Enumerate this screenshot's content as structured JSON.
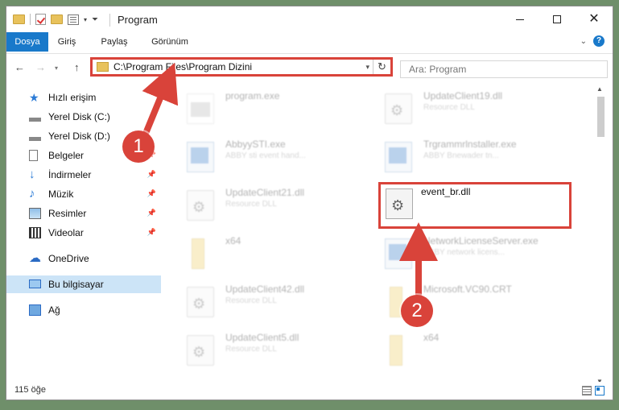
{
  "window": {
    "title": "Program"
  },
  "ribbon": {
    "tabs": [
      "Dosya",
      "Giriş",
      "Paylaş",
      "Görünüm"
    ]
  },
  "address": {
    "path": "C:\\Program Files\\Program Dizini"
  },
  "search": {
    "placeholder": "Ara: Program"
  },
  "nav": {
    "items": [
      {
        "label": "Hızlı erişim",
        "icon": "star-icon"
      },
      {
        "label": "Yerel Disk (C:)",
        "icon": "drive-icon"
      },
      {
        "label": "Yerel Disk (D:)",
        "icon": "drive-icon"
      },
      {
        "label": "Belgeler",
        "icon": "document-icon"
      },
      {
        "label": "İndirmeler",
        "icon": "download-icon"
      },
      {
        "label": "Müzik",
        "icon": "music-icon"
      },
      {
        "label": "Resimler",
        "icon": "pictures-icon"
      },
      {
        "label": "Videolar",
        "icon": "videos-icon"
      },
      {
        "label": "OneDrive",
        "icon": "cloud-icon"
      },
      {
        "label": "Bu bilgisayar",
        "icon": "computer-icon"
      },
      {
        "label": "Ağ",
        "icon": "network-icon"
      }
    ]
  },
  "files": [
    {
      "name": "program.exe",
      "sub": ""
    },
    {
      "name": "UpdateClient19.dll",
      "sub": "Resource DLL"
    },
    {
      "name": "AbbyySTI.exe",
      "sub": "ABBY sti event hand..."
    },
    {
      "name": "Trgrammrlnstaller.exe",
      "sub": "ABBY Bnewader tn..."
    },
    {
      "name": "UpdateClient21.dll",
      "sub": "Resource DLL"
    },
    {
      "name": "event_br.dll",
      "sub": ""
    },
    {
      "name": "x64",
      "sub": ""
    },
    {
      "name": "NetworkLicenseServer.exe",
      "sub": "ABBY network licens..."
    },
    {
      "name": "UpdateClient42.dll",
      "sub": "Resource DLL"
    },
    {
      "name": "Microsoft.VC90.CRT",
      "sub": ""
    },
    {
      "name": "UpdateClient5.dll",
      "sub": "Resource DLL"
    },
    {
      "name": "x64",
      "sub": ""
    }
  ],
  "status": {
    "count": "115 öğe"
  },
  "annotations": {
    "one": "1",
    "two": "2"
  },
  "colors": {
    "accent": "#1979ca",
    "highlight": "#d9433a"
  }
}
